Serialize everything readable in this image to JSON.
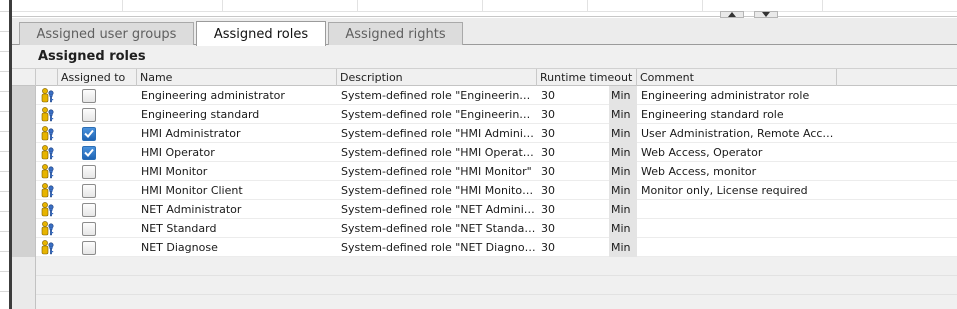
{
  "tabs": [
    {
      "label": "Assigned user groups",
      "active": false
    },
    {
      "label": "Assigned roles",
      "active": true
    },
    {
      "label": "Assigned rights",
      "active": false
    }
  ],
  "section_title": "Assigned roles",
  "columns": {
    "assigned_to": "Assigned to",
    "name": "Name",
    "description": "Description",
    "runtime_timeout": "Runtime timeout",
    "comment": "Comment"
  },
  "rows": [
    {
      "icon": "role-icon",
      "assigned": false,
      "name": "Engineering administrator",
      "description": "System-defined role \"Engineering a...",
      "timeout": "30",
      "unit": "Min",
      "comment": "Engineering administrator role"
    },
    {
      "icon": "role-icon",
      "assigned": false,
      "name": "Engineering standard",
      "description": "System-defined role \"Engineering s...",
      "timeout": "30",
      "unit": "Min",
      "comment": "Engineering standard role"
    },
    {
      "icon": "role-icon",
      "assigned": true,
      "name": "HMI Administrator",
      "description": "System-defined role \"HMI Administ...",
      "timeout": "30",
      "unit": "Min",
      "comment": "User Administration, Remote Acce..."
    },
    {
      "icon": "role-icon",
      "assigned": true,
      "name": "HMI Operator",
      "description": "System-defined role \"HMI Operator\"",
      "timeout": "30",
      "unit": "Min",
      "comment": "Web Access, Operator"
    },
    {
      "icon": "role-icon",
      "assigned": false,
      "name": "HMI Monitor",
      "description": "System-defined role \"HMI Monitor\"",
      "timeout": "30",
      "unit": "Min",
      "comment": "Web Access, monitor"
    },
    {
      "icon": "role-icon",
      "assigned": false,
      "name": "HMI Monitor Client",
      "description": "System-defined role \"HMI Monitor ...",
      "timeout": "30",
      "unit": "Min",
      "comment": "Monitor only, License required"
    },
    {
      "icon": "role-icon",
      "assigned": false,
      "name": "NET Administrator",
      "description": "System-defined role \"NET Administ...",
      "timeout": "30",
      "unit": "Min",
      "comment": ""
    },
    {
      "icon": "role-icon",
      "assigned": false,
      "name": "NET Standard",
      "description": "System-defined role \"NET Standard\"",
      "timeout": "30",
      "unit": "Min",
      "comment": ""
    },
    {
      "icon": "role-icon",
      "assigned": false,
      "name": "NET Diagnose",
      "description": "System-defined role \"NET Diagnose\"",
      "timeout": "30",
      "unit": "Min",
      "comment": ""
    }
  ],
  "colors": {
    "checkbox_checked": "#1f64b4",
    "tab_active_bg": "#ffffff",
    "panel_bg": "#f0f0f0"
  }
}
